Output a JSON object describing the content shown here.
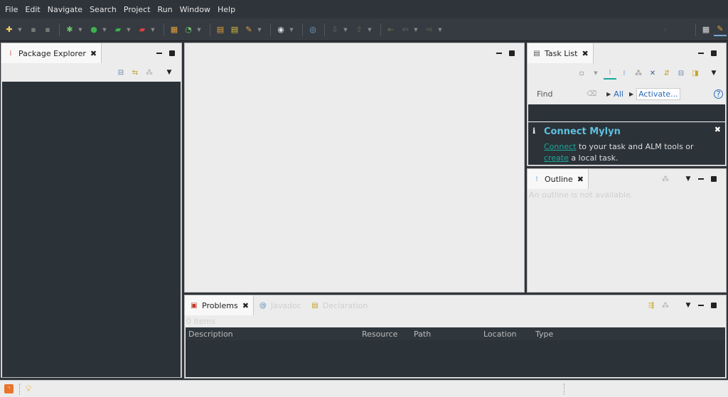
{
  "menu": [
    "File",
    "Edit",
    "Navigate",
    "Search",
    "Project",
    "Run",
    "Window",
    "Help"
  ],
  "toolbar": {
    "icons": [
      "new-icon",
      "save-icon",
      "save-all-icon",
      "debug-icon",
      "run-icon",
      "coverage-icon",
      "external-tools-icon",
      "new-java-project-icon",
      "new-package-icon",
      "new-class-icon",
      "open-type-icon",
      "open-task-icon",
      "search-icon",
      "next-annotation-icon",
      "prev-annotation-icon",
      "last-edit-icon",
      "back-icon",
      "forward-icon",
      "open-perspective-icon",
      "java-perspective-icon"
    ]
  },
  "package_explorer": {
    "title": "Package Explorer"
  },
  "task_list": {
    "title": "Task List",
    "find_placeholder": "Find",
    "all_label": "All",
    "activate_label": "Activate..."
  },
  "connect_mylyn": {
    "title": "Connect Mylyn",
    "connect_link": "Connect",
    "text_middle": " to your task and ALM tools or ",
    "create_link": "create",
    "text_end": " a local task."
  },
  "outline": {
    "title": "Outline",
    "message": "An outline is not available."
  },
  "problems": {
    "title": "Problems",
    "tab2": "Javadoc",
    "tab3": "Declaration",
    "items_count": "0 items",
    "columns": [
      "Description",
      "Resource",
      "Path",
      "Location",
      "Type"
    ]
  },
  "colors": {
    "accent_green": "#1aa899",
    "dark_panel": "#2b3238"
  }
}
